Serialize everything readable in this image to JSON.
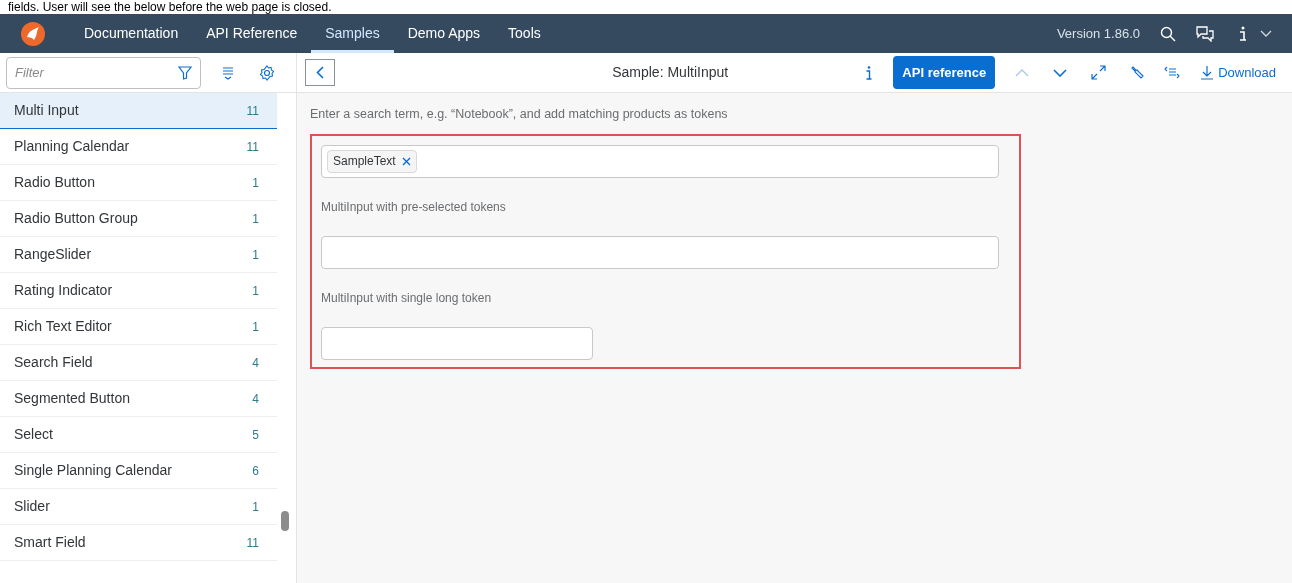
{
  "caption": "fields. User will see the below before the web page is closed.",
  "nav": {
    "tabs": [
      {
        "label": "Documentation",
        "selected": false
      },
      {
        "label": "API Reference",
        "selected": false
      },
      {
        "label": "Samples",
        "selected": true
      },
      {
        "label": "Demo Apps",
        "selected": false
      },
      {
        "label": "Tools",
        "selected": false
      }
    ],
    "version": "Version 1.86.0"
  },
  "sidebar": {
    "filter": {
      "placeholder": "Filter"
    },
    "items": [
      {
        "label": "Multi Input",
        "count": "11",
        "selected": true
      },
      {
        "label": "Planning Calendar",
        "count": "11",
        "selected": false
      },
      {
        "label": "Radio Button",
        "count": "1",
        "selected": false
      },
      {
        "label": "Radio Button Group",
        "count": "1",
        "selected": false
      },
      {
        "label": "RangeSlider",
        "count": "1",
        "selected": false
      },
      {
        "label": "Rating Indicator",
        "count": "1",
        "selected": false
      },
      {
        "label": "Rich Text Editor",
        "count": "1",
        "selected": false
      },
      {
        "label": "Search Field",
        "count": "4",
        "selected": false
      },
      {
        "label": "Segmented Button",
        "count": "4",
        "selected": false
      },
      {
        "label": "Select",
        "count": "5",
        "selected": false
      },
      {
        "label": "Single Planning Calendar",
        "count": "6",
        "selected": false
      },
      {
        "label": "Slider",
        "count": "1",
        "selected": false
      },
      {
        "label": "Smart Field",
        "count": "11",
        "selected": false
      }
    ]
  },
  "toolbar": {
    "title": "Sample: MultiInput",
    "api_button": "API reference",
    "download": "Download"
  },
  "sample": {
    "intro": "Enter a search term, e.g. “Notebook”, and add matching products as tokens",
    "inputs": [
      {
        "tokens": [
          "SampleText"
        ],
        "wide": true
      },
      {
        "label": "MultiInput with pre-selected tokens",
        "wide": true
      },
      {
        "label": "MultiInput with single long token",
        "wide": false
      }
    ]
  }
}
